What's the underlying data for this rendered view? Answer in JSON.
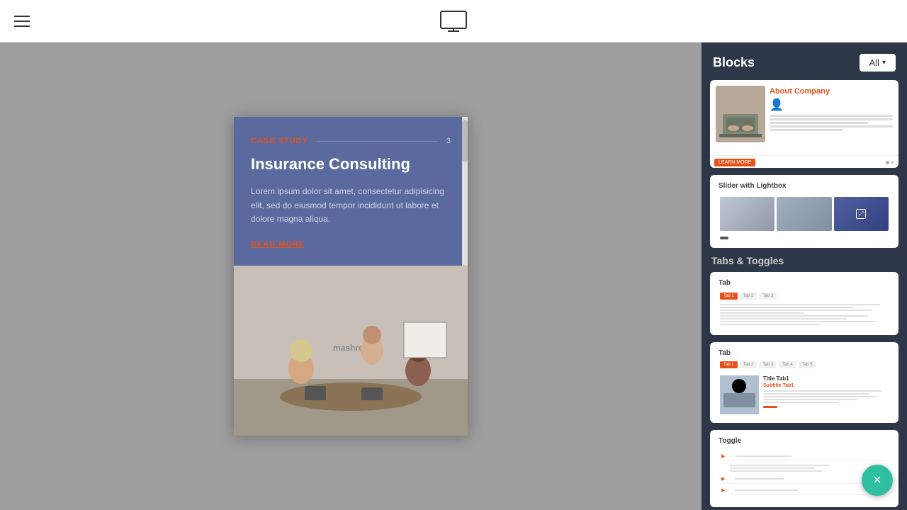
{
  "header": {
    "menu_icon": "menu-icon",
    "monitor_icon": "monitor-icon"
  },
  "canvas": {
    "preview_card": {
      "case_study_label": "CASE STUDY",
      "case_study_number": "3",
      "title": "Insurance Consulting",
      "body": "Lorem ipsum dolor sit amet, consectetur adipisicing elit, sed do eiusmod tempor incididunt ut labore et dolore magna aliqua.",
      "read_more": "READ MORE"
    }
  },
  "sidebar": {
    "title": "Blocks",
    "all_button": "All",
    "blocks": [
      {
        "name": "about-company",
        "label": "About Company",
        "type": "about"
      },
      {
        "name": "slider-with-lightbox",
        "label": "Slider with Lightbox",
        "type": "slider"
      }
    ],
    "sections": [
      {
        "label": "Tabs & Toggles",
        "blocks": [
          {
            "name": "tab-1",
            "label": "Tab",
            "type": "tab1"
          },
          {
            "name": "tab-2",
            "label": "Tab",
            "type": "tab2"
          },
          {
            "name": "toggle-1",
            "label": "Toggle",
            "type": "toggle"
          }
        ]
      }
    ],
    "close_button": "×"
  }
}
